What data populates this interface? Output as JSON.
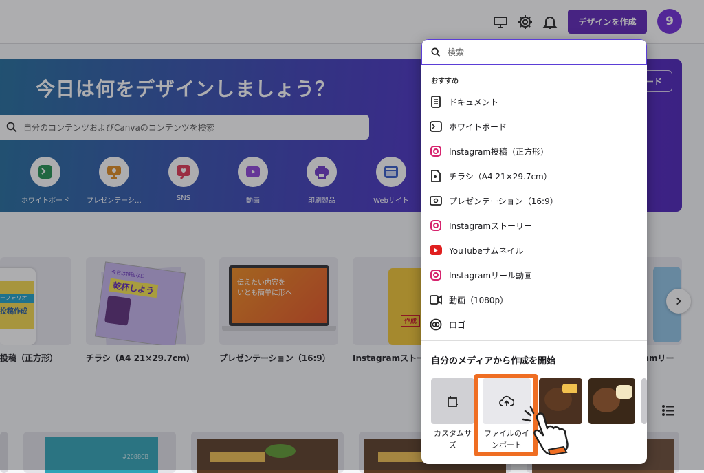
{
  "topbar": {
    "create_label": "デザインを作成",
    "avatar_initial": "9"
  },
  "hero": {
    "title": "今日は何をデザインしましょう？",
    "search_placeholder": "自分のコンテンツおよびCanvaのコンテンツを検索",
    "extra_label": "ード",
    "categories": [
      {
        "label": "ホワイトボード",
        "icon": "whiteboard-icon",
        "color": "#1e8f4e"
      },
      {
        "label": "プレゼンテーシ…",
        "icon": "presentation-icon",
        "color": "#e08a1a"
      },
      {
        "label": "SNS",
        "icon": "heart-chat-icon",
        "color": "#e0334f"
      },
      {
        "label": "動画",
        "icon": "video-icon",
        "color": "#8b3fd9"
      },
      {
        "label": "印刷製品",
        "icon": "printer-icon",
        "color": "#6b35c9"
      },
      {
        "label": "Webサイト",
        "icon": "website-icon",
        "color": "#3057c9"
      }
    ]
  },
  "templates": [
    {
      "label": "投稿（正方形）"
    },
    {
      "label": "チラシ（A4 21×29.7cm)"
    },
    {
      "label": "プレゼンテーション（16:9）"
    },
    {
      "label": "Instagramストー"
    },
    {
      "label": "ramリー"
    }
  ],
  "template_art": {
    "flyer_title": "乾杯しよう",
    "flyer_sub": "今日は特別な日",
    "pres_line1": "伝えたい内容を",
    "pres_line2": "いとも簡単に形へ",
    "story_tag": "作成",
    "post_tag": "投稿作成",
    "post_band": "ーフォリオ",
    "color_code": "#2088CB"
  },
  "panel": {
    "search_placeholder": "検索",
    "section_label": "おすすめ",
    "items": [
      {
        "label": "ドキュメント",
        "icon": "document-icon"
      },
      {
        "label": "ホワイトボード",
        "icon": "whiteboard-icon"
      },
      {
        "label": "Instagram投稿（正方形）",
        "icon": "instagram-icon"
      },
      {
        "label": "チラシ（A4 21×29.7cm）",
        "icon": "flyer-icon"
      },
      {
        "label": "プレゼンテーション（16:9）",
        "icon": "presentation-icon"
      },
      {
        "label": "Instagramストーリー",
        "icon": "instagram-icon"
      },
      {
        "label": "YouTubeサムネイル",
        "icon": "youtube-icon"
      },
      {
        "label": "Instagramリール動画",
        "icon": "instagram-icon"
      },
      {
        "label": "動画（1080p）",
        "icon": "video-icon"
      },
      {
        "label": "ロゴ",
        "icon": "logo-icon"
      }
    ],
    "media_title": "自分のメディアから作成を開始",
    "custom_size_label_1": "カスタムサ",
    "custom_size_label_2": "ズ",
    "import_label_1": "ファイルのイ",
    "import_label_2": "ンポート"
  },
  "colors": {
    "brand": "#5b21b6",
    "highlight": "#ef6e23"
  }
}
